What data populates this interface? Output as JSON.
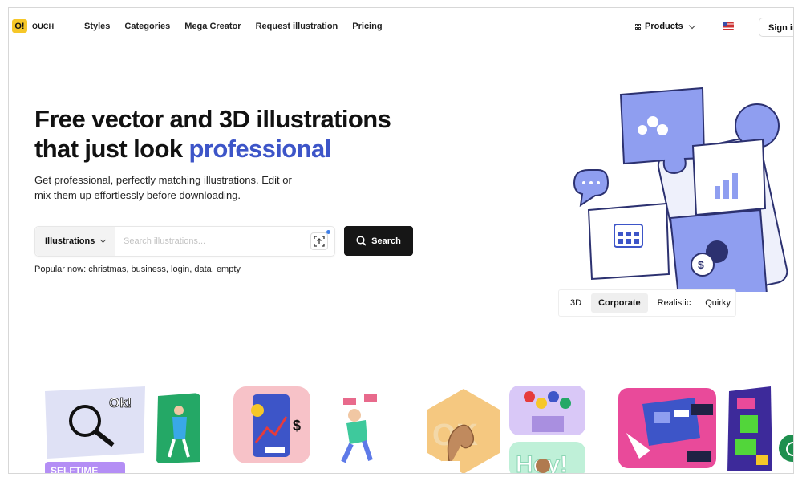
{
  "brand": {
    "badge": "O!",
    "name": "OUCH"
  },
  "nav": {
    "items": [
      "Styles",
      "Categories",
      "Mega Creator",
      "Request illustration",
      "Pricing"
    ],
    "products_label": "Products",
    "signin_label": "Sign in"
  },
  "hero": {
    "title_line1": "Free vector and 3D illustrations",
    "title_line2_prefix": "that just look ",
    "title_accent": "professional",
    "subtitle": "Get professional, perfectly matching illustrations. Edit or mix them up effortlessly before downloading."
  },
  "search": {
    "type_label": "Illustrations",
    "placeholder": "Search illustrations...",
    "button_label": "Search"
  },
  "popular": {
    "prefix": "Popular now:",
    "tags": [
      "christmas",
      "business",
      "login",
      "data",
      "empty"
    ]
  },
  "style_tabs": {
    "items": [
      "3D",
      "Corporate",
      "Realistic",
      "Quirky"
    ],
    "active": "Corporate"
  },
  "gallery": {
    "texts": [
      "Ok!",
      "SELFTIME",
      "OK",
      "Hey!"
    ]
  },
  "colors": {
    "accent": "#3d55c8",
    "logo_yellow": "#f6c728",
    "search_button": "#161616",
    "chat_green": "#1e8f4e",
    "puzzle_blue": "#8f9ef0"
  }
}
